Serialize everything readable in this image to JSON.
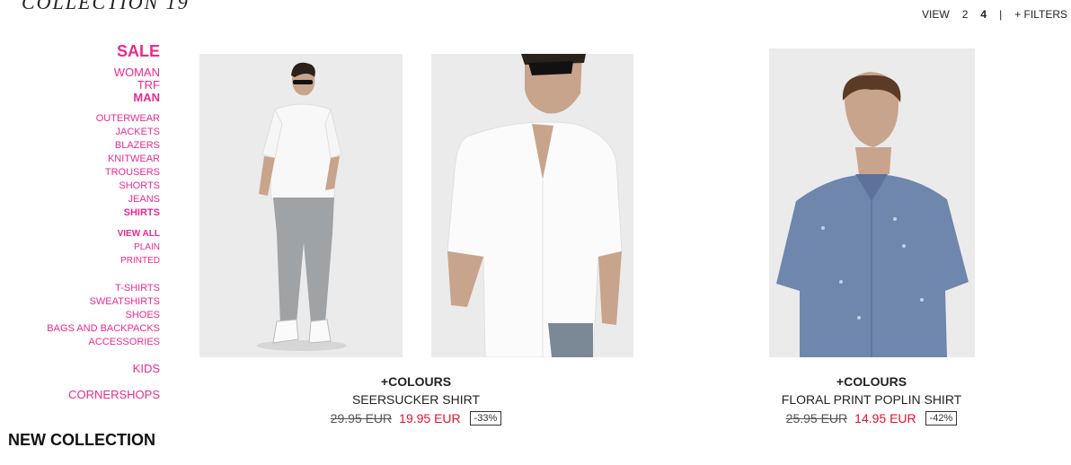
{
  "logo": "COLLECTION 19",
  "topbar": {
    "view": "VIEW",
    "opt2": "2",
    "opt4": "4",
    "sep": "|",
    "filters": "+ FILTERS"
  },
  "sidebar": {
    "sale": "SALE",
    "woman": "WOMAN",
    "trf": "TRF",
    "man": "MAN",
    "categories": [
      "OUTERWEAR",
      "JACKETS",
      "BLAZERS",
      "KNITWEAR",
      "TROUSERS",
      "SHORTS",
      "JEANS",
      "SHIRTS"
    ],
    "shirts_sub": [
      "VIEW ALL",
      "PLAIN",
      "PRINTED"
    ],
    "more": [
      "T-SHIRTS",
      "SWEATSHIRTS",
      "SHOES",
      "BAGS AND BACKPACKS",
      "ACCESSORIES"
    ],
    "kids": "KIDS",
    "cornershops": "CORNERSHOPS",
    "new_collection": "NEW COLLECTION"
  },
  "products": [
    {
      "colours": "+COLOURS",
      "name": "SEERSUCKER SHIRT",
      "old_price": "29.95 EUR",
      "new_price": "19.95 EUR",
      "discount": "-33%"
    },
    {
      "colours": "+COLOURS",
      "name": "FLORAL PRINT POPLIN SHIRT",
      "old_price": "25.95 EUR",
      "new_price": "14.95 EUR",
      "discount": "-42%"
    }
  ],
  "colors": {
    "accent": "#ec2a8d",
    "sale_price": "#e8112d"
  }
}
